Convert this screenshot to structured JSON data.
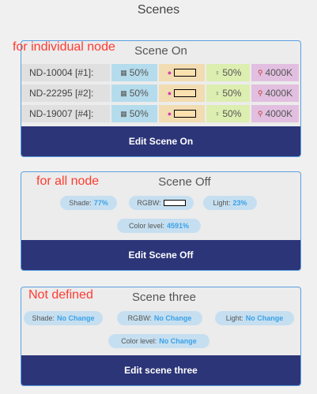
{
  "page_title": "Scenes",
  "scene_on": {
    "title": "Scene On",
    "annotation": "for individual node",
    "nodes": [
      {
        "label": "ND-10004 [#1]:",
        "shade": "50%",
        "light": "50%",
        "temp": "4000K"
      },
      {
        "label": "ND-22295 [#2]:",
        "shade": "50%",
        "light": "50%",
        "temp": "4000K"
      },
      {
        "label": "ND-19007 [#4]:",
        "shade": "50%",
        "light": "50%",
        "temp": "4000K"
      }
    ],
    "edit_label": "Edit Scene On"
  },
  "scene_off": {
    "title": "Scene Off",
    "annotation": "for all node",
    "shade_label": "Shade:",
    "shade_value": "77%",
    "rgbw_label": "RGBW:",
    "light_label": "Light:",
    "light_value": "23%",
    "color_label": "Color level:",
    "color_value": "4591%",
    "edit_label": "Edit Scene Off"
  },
  "scene_three": {
    "title": "Scene three",
    "annotation": "Not defined",
    "shade_label": "Shade:",
    "shade_value": "No Change",
    "rgbw_label": "RGBW:",
    "rgbw_value": "No Change",
    "light_label": "Light:",
    "light_value": "No Change",
    "color_label": "Color level:",
    "color_value": "No Change",
    "edit_label": "Edit scene three"
  },
  "colors": {
    "accent": "#2c3578",
    "border": "#5ba0e0",
    "annotation": "#ff3b30",
    "value": "#3aa1e8"
  },
  "icons": {
    "shade": "shade-icon",
    "rgbw": "rgbw-icon",
    "light": "bulb-icon",
    "temp": "thermometer-icon"
  }
}
